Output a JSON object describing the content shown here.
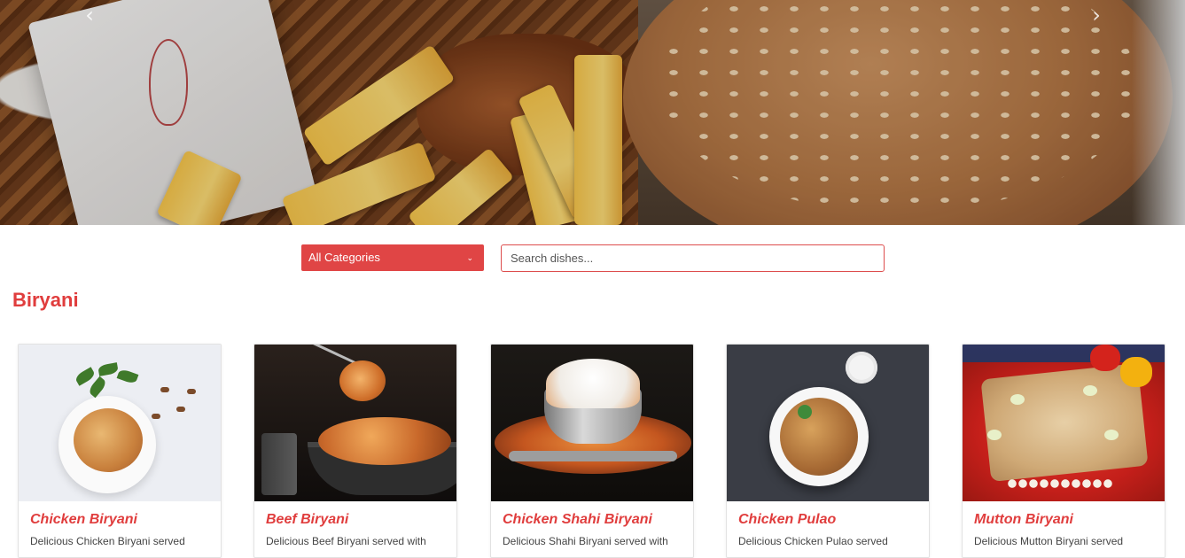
{
  "hero": {
    "prev_glyph": "‹",
    "next_glyph": "›"
  },
  "filters": {
    "category_selected": "All Categories",
    "chevron_glyph": "⌄",
    "search_placeholder": "Search dishes..."
  },
  "section": {
    "title": "Biryani",
    "accent_color": "#e03d3d",
    "items": [
      {
        "title": "Chicken Biryani",
        "desc": "Delicious Chicken Biryani served"
      },
      {
        "title": "Beef Biryani",
        "desc": "Delicious Beef Biryani served with"
      },
      {
        "title": "Chicken Shahi Biryani",
        "desc": "Delicious Shahi Biryani served with"
      },
      {
        "title": "Chicken Pulao",
        "desc": "Delicious Chicken Pulao served"
      },
      {
        "title": "Mutton Biryani",
        "desc": "Delicious Mutton Biryani served"
      }
    ]
  }
}
